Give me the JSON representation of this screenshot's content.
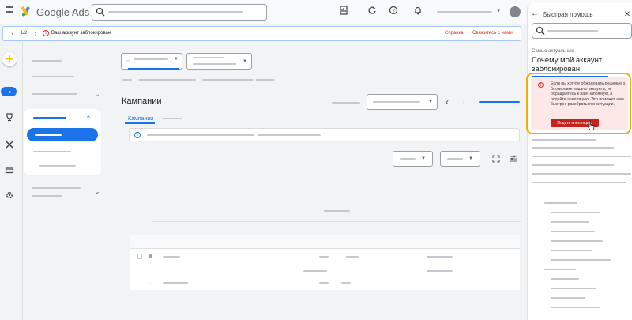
{
  "header": {
    "app_name": "Google Ads",
    "brand_colors": [
      "#4285f4",
      "#fbbc04",
      "#34a853"
    ],
    "icons": [
      "menu-icon",
      "search-icon",
      "reports-icon",
      "refresh-icon",
      "help-icon",
      "notifications-icon",
      "avatar"
    ]
  },
  "notice": {
    "count": "1/2",
    "text": "Ваш аккаунт заблокирован",
    "link_appeal": "Справка",
    "link_contact": "Свяжитесь с нами"
  },
  "rail": {
    "create_icon": "+",
    "items": [
      "campaigns-icon",
      "goals-icon",
      "tools-icon",
      "billing-icon",
      "admin-icon"
    ],
    "accent": "#1a73e8"
  },
  "main": {
    "title": "Кампании",
    "tabs": [
      {
        "label": "Кампании"
      }
    ]
  },
  "help_panel": {
    "title": "Быстрая помощь",
    "section_label": "Самые актуальные",
    "question": "Почему мой аккаунт заблокирован",
    "alert_text": "Если вы хотите обжаловать решение о блокировке вашего аккаунта, не обращайтесь к нам напрямую, а подайте апелляцию. Это поможет нам быстрее разобраться в ситуации.",
    "appeal_button": "Подать апелляцию",
    "alert_color": "#d93025",
    "highlight_color": "#f9ab00"
  }
}
